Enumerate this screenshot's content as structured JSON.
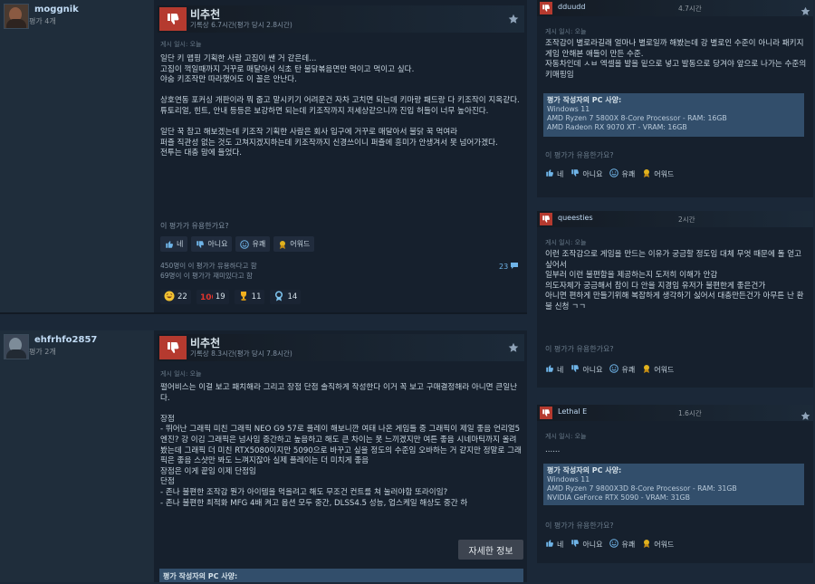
{
  "left_reviews": [
    {
      "author": "moggnik",
      "review_count": "평가 4개",
      "verdict": "비추천",
      "hours": "기록상 6.7시간(평가 당시 2.8시간)",
      "posted": "게시 일시: 오늘",
      "body": "일단 키 맵핑 기획한 사람 고집이 쌘 거 같은데...\n고집이 꺽일때까지 거꾸로 매달아서 식초 탄 불닭볶음면만 먹이고 먹이고 싶다.\n야숨 키조작만 따라했어도 이 꼴은 안난다.\n\n상호연동 포커싱 개판이라 뭐 줍고 말시키기 어려운건 자차 고치면 되는데 키마랑 패드랑 다 키조작이 지옥같다.\n튜토리얼, 힌트, 안내 등등은 보강하면 되는데 키조작까지 저세상같으니까 진입 허들이 너무 높아진다.\n\n일단 꾹 참고 해보겠는데 키조작 기획한 사람은 회사 입구에 거꾸로 매달아서 불닭 꾹 먹여라\n퍼즐 직관성 없는 것도 고쳐지겠지하는데 키조작까지 신경쓰이니 퍼즐에 흥미가 안생겨서 못 넘어가겠다.\n전투는 대충 맘에 들었다.",
      "helpful_q": "이 평가가 유용한가요?",
      "buttons": [
        "네",
        "아니요",
        "유쾌",
        "어워드"
      ],
      "stat_helpful": "450명이 이 평가가 유용하다고 함",
      "stat_funny": "69명이 이 평가가 재미있다고 함",
      "comments": "23",
      "awards": [
        {
          "icon": "laugh-award-icon",
          "count": "22"
        },
        {
          "icon": "hundred-award-icon",
          "count": "19"
        },
        {
          "icon": "trophy-award-icon",
          "count": "11"
        },
        {
          "icon": "medal-award-icon",
          "count": "14"
        }
      ]
    },
    {
      "author": "ehfrhfo2857",
      "review_count": "평가 2개",
      "verdict": "비추천",
      "hours": "기록상 8.3시간(평가 당시 7.8시간)",
      "posted": "게시 일시: 오늘",
      "body": "펄어비스는 이걸 보고 패치해라 그리고 장점 단점 솔직하게 작성한다 이거 꼭 보고 구매결정해라 아니면 큰일난다.\n\n장점\n- 뛰어난 그래픽 미친 그래픽 NEO G9 57로 플레이 해보니깐 여태 나온 게임들 중 그래픽이 제일 좋음 언리얼5 엔진? 강 이김 그래픽은 넘사임 중간하고 높음하고 해도 큰 차이는 못 느끼겠지만 여튼 좋음 시네마틱까지 올려봤는데 그래픽 더 미친 RTX5080이지만 5090으로 바꾸고 싶을 정도의 수준임 오바하는 거 같지만 정말로 그래픽은 좋음 스샷만 봐도 느껴지잖아 실제 플레이는 더 미치게 좋음\n장점은 이게 끝임 이제 단점임\n단점\n- 존나 불편한 조작감 뭔가 아이템을 먹을려고 해도 무조건 컨트를 쳐 눌러야함 또라이임?\n- 존나 불편한 최적화 MFG 4배 켜고 옵션 모두 중간, DLSS4.5 성능, 업스케일 해상도 중간 하",
      "detail_button": "자세한 정보",
      "pc_specs_title": "평가 작성자의 PC 사양:"
    }
  ],
  "right_reviews": [
    {
      "author": "dduudd",
      "time": "4.7시간",
      "posted": "게시 일시: 오늘",
      "body": "조작감이 별로라길래 얼마나 별로일까 해봤는데 강 별로인 수준이 아니라 패키지게임 안해본 애들이 만든 수준.\n자동차인데 ㅅㅂ 엑셀을 발을 밑으로 넣고 발동으로 당겨야 앞으로 나가는 수준의 키매핑임",
      "pc_title": "평가 작성자의 PC 사양:",
      "pc_lines": [
        "Windows 11",
        "AMD Ryzen 7 5800X 8-Core Processor - RAM: 16GB",
        "AMD Radeon RX 9070 XT - VRAM: 16GB"
      ],
      "helpful_q": "이 평가가 유용한가요?",
      "buttons": [
        "네",
        "아니요",
        "유쾌",
        "어워드"
      ]
    },
    {
      "author": "queesties",
      "time": "2시간",
      "posted": "게시 일시: 오늘",
      "body": "이런 조작감으로 게임을 만드는 이유가 궁금할 정도임 대체 무엇 때문에 돌 얻고 싶어서\n일부러 이런 불편함을 제공하는지 도저히 이해가 안감\n의도자체가 궁금해서 참이 다 안을 지경임 유저가 불편한게 좋은건가\n아니면 편하게 만들기위해 복잡하게 생각하기 싫어서 대충만든건가 아무튼 난 환불 신청 ㄱㄱ",
      "helpful_q": "이 평가가 유용한가요?",
      "buttons": [
        "네",
        "아니요",
        "유쾌",
        "어워드"
      ]
    },
    {
      "author": "Lethal E",
      "time": "1.6시간",
      "posted": "게시 일시: 오늘",
      "body": "......",
      "pc_title": "평가 작성자의 PC 사양:",
      "pc_lines": [
        "Windows 11",
        "AMD Ryzen 7 9800X3D 8-Core Processor - RAM: 31GB",
        "NVIDIA GeForce RTX 5090 - VRAM: 31GB"
      ],
      "helpful_q": "이 평가가 유용한가요?",
      "buttons": [
        "네",
        "아니요",
        "유쾌",
        "어워드"
      ]
    }
  ],
  "colors": {
    "thumb_down": "#b53a2f",
    "spec_box": "#324e6b",
    "link": "#6fb4e8"
  }
}
